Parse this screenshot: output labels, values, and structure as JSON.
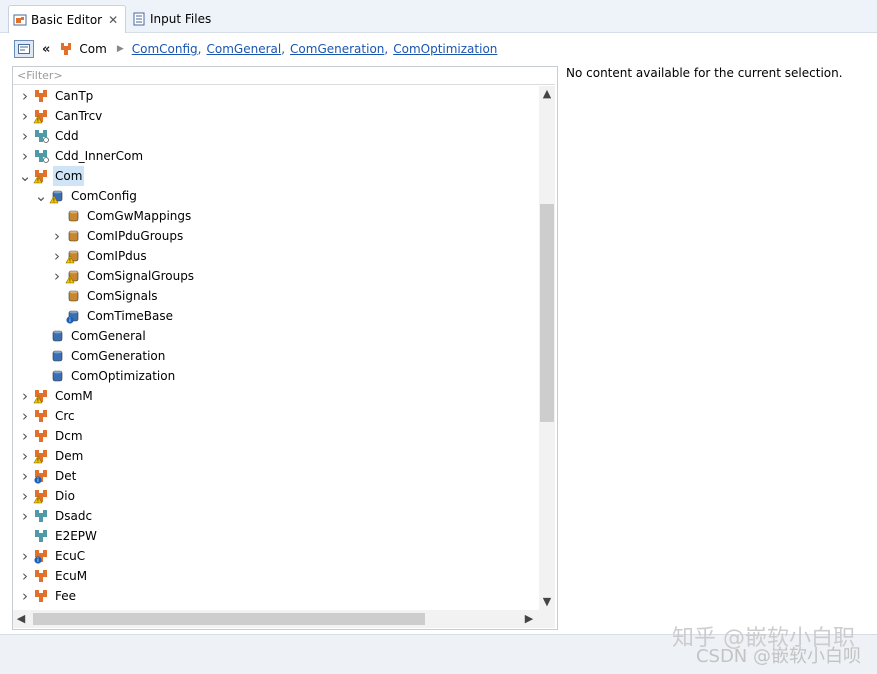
{
  "tabs": [
    {
      "label": "Basic Editor",
      "icon": "basic-editor-icon",
      "active": true,
      "closable": true
    },
    {
      "label": "Input Files",
      "icon": "input-files-icon",
      "active": false
    }
  ],
  "breadcrumb": {
    "root": "Com",
    "links": [
      "ComConfig",
      "ComGeneral",
      "ComGeneration",
      "ComOptimization"
    ],
    "separator": ","
  },
  "filter": {
    "placeholder": "<Filter>"
  },
  "tree": [
    {
      "label": "CanTp",
      "icon": "module-icon",
      "expandable": true,
      "expanded": false,
      "level": 0
    },
    {
      "label": "CanTrcv",
      "icon": "module-warning-icon",
      "expandable": true,
      "expanded": false,
      "level": 0
    },
    {
      "label": "Cdd",
      "icon": "cdd-module-icon",
      "expandable": true,
      "expanded": false,
      "level": 0
    },
    {
      "label": "Cdd_InnerCom",
      "icon": "cdd-module-icon",
      "expandable": true,
      "expanded": false,
      "level": 0
    },
    {
      "label": "Com",
      "icon": "module-warning-icon",
      "expandable": true,
      "expanded": true,
      "selected": true,
      "level": 0
    },
    {
      "label": "ComConfig",
      "icon": "container-warning-icon",
      "expandable": true,
      "expanded": true,
      "level": 1
    },
    {
      "label": "ComGwMappings",
      "icon": "container-list-icon",
      "expandable": false,
      "level": 2
    },
    {
      "label": "ComIPduGroups",
      "icon": "container-list-icon",
      "expandable": true,
      "expanded": false,
      "level": 2
    },
    {
      "label": "ComIPdus",
      "icon": "container-list-warning-icon",
      "expandable": true,
      "expanded": false,
      "level": 2
    },
    {
      "label": "ComSignalGroups",
      "icon": "container-list-warning-icon",
      "expandable": true,
      "expanded": false,
      "level": 2
    },
    {
      "label": "ComSignals",
      "icon": "container-list-icon",
      "expandable": false,
      "level": 2
    },
    {
      "label": "ComTimeBase",
      "icon": "container-info-icon",
      "expandable": false,
      "level": 2
    },
    {
      "label": "ComGeneral",
      "icon": "container-icon",
      "expandable": false,
      "level": 1
    },
    {
      "label": "ComGeneration",
      "icon": "container-icon",
      "expandable": false,
      "level": 1
    },
    {
      "label": "ComOptimization",
      "icon": "container-icon",
      "expandable": false,
      "level": 1
    },
    {
      "label": "ComM",
      "icon": "module-warning-icon",
      "expandable": true,
      "expanded": false,
      "level": 0
    },
    {
      "label": "Crc",
      "icon": "module-icon",
      "expandable": true,
      "expanded": false,
      "level": 0
    },
    {
      "label": "Dcm",
      "icon": "module-icon",
      "expandable": true,
      "expanded": false,
      "level": 0
    },
    {
      "label": "Dem",
      "icon": "module-warning-icon",
      "expandable": true,
      "expanded": false,
      "level": 0
    },
    {
      "label": "Det",
      "icon": "module-info-icon",
      "expandable": true,
      "expanded": false,
      "level": 0
    },
    {
      "label": "Dio",
      "icon": "module-warning-icon",
      "expandable": true,
      "expanded": false,
      "level": 0
    },
    {
      "label": "Dsadc",
      "icon": "module-teal-icon",
      "expandable": true,
      "expanded": false,
      "level": 0
    },
    {
      "label": "E2EPW",
      "icon": "module-teal-icon",
      "expandable": false,
      "level": 0
    },
    {
      "label": "EcuC",
      "icon": "module-info-icon",
      "expandable": true,
      "expanded": false,
      "level": 0
    },
    {
      "label": "EcuM",
      "icon": "module-icon",
      "expandable": true,
      "expanded": false,
      "level": 0
    },
    {
      "label": "Fee",
      "icon": "module-icon",
      "expandable": true,
      "expanded": false,
      "level": 0
    }
  ],
  "content": {
    "message": "No content available for the current selection."
  },
  "watermark": {
    "line1": "知乎 @嵌软小白职",
    "line2": "CSDN @嵌软小白呗"
  },
  "colors": {
    "module": "#e0702a",
    "teal": "#4f9aa6",
    "container": "#3a6fb3",
    "container_list": "#c8872a",
    "selection": "#cfe4f7",
    "link": "#1a56b0"
  }
}
